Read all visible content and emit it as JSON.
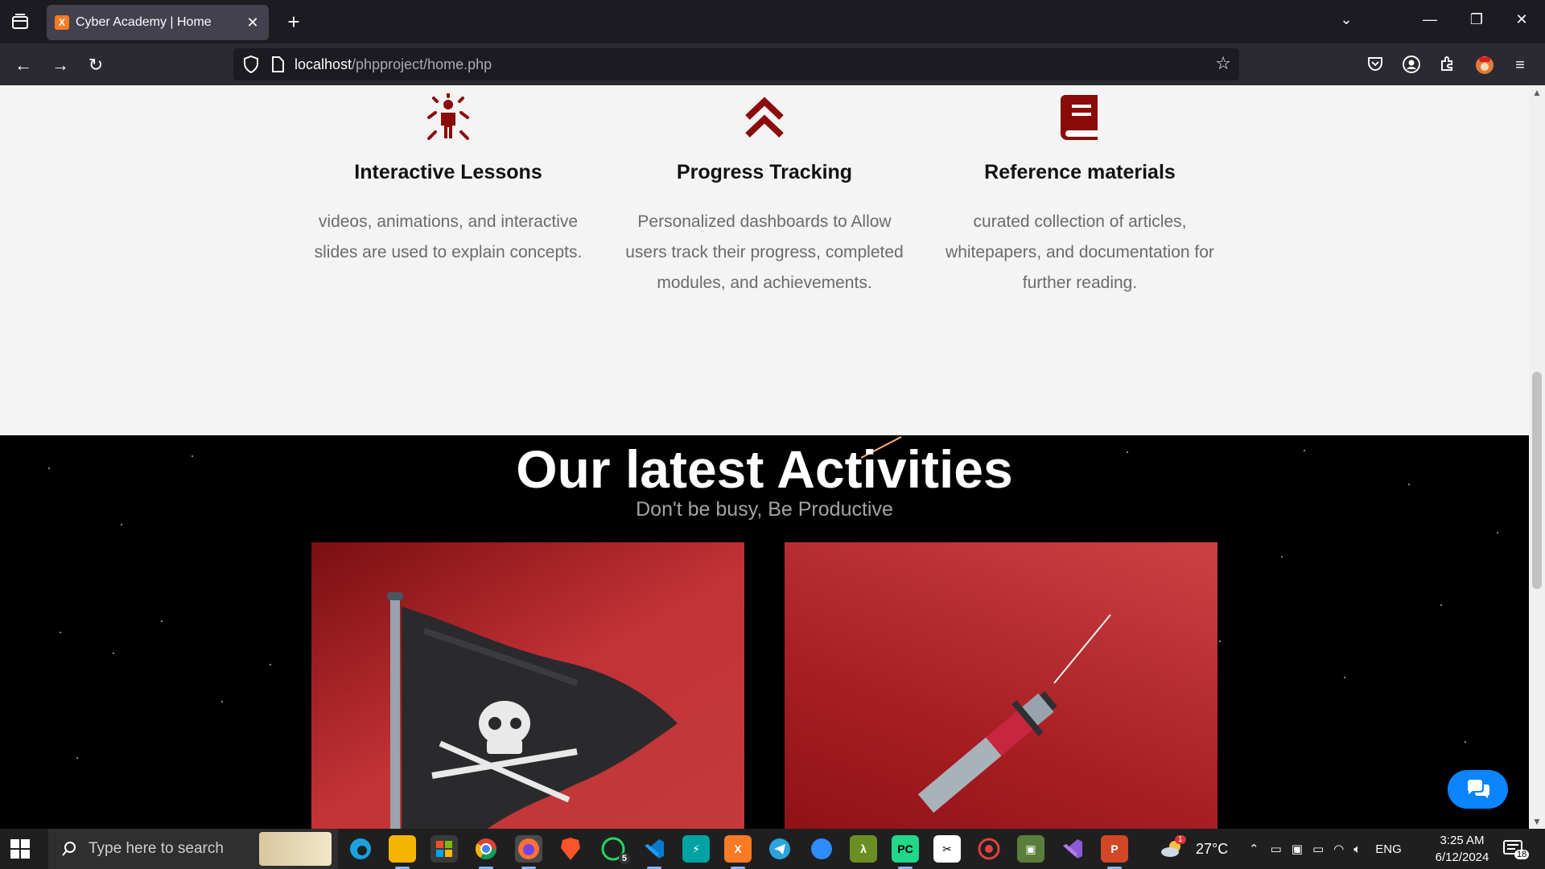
{
  "browser": {
    "tab_title": "Cyber Academy | Home",
    "favicon_text": "X",
    "url_host": "localhost",
    "url_path": "/phpproject/home.php"
  },
  "features": [
    {
      "icon": "person-radiating-icon",
      "title": "Interactive Lessons",
      "description": "videos, animations, and interactive slides are used to explain concepts."
    },
    {
      "icon": "double-chevron-up-icon",
      "title": "Progress Tracking",
      "description": "Personalized dashboards to Allow users track their progress, completed modules, and achievements."
    },
    {
      "icon": "book-icon",
      "title": "Reference materials",
      "description": "curated collection of articles, whitepapers, and documentation for further reading."
    }
  ],
  "activities": {
    "title": "Our latest Activities",
    "subtitle": "Don't be busy, Be Productive",
    "cards": [
      {
        "image": "pirate-flag"
      },
      {
        "image": "syringe"
      }
    ]
  },
  "colors": {
    "accent": "#8b0a0a",
    "card_red": "#c23236",
    "chat_blue": "#0a84ff"
  },
  "taskbar": {
    "search_placeholder": "Type here to search",
    "weather": "27°C",
    "language": "ENG",
    "time": "3:25 AM",
    "date": "6/12/2024",
    "notifications": "18",
    "whatsapp_badge": "5",
    "weather_badge": "1"
  }
}
